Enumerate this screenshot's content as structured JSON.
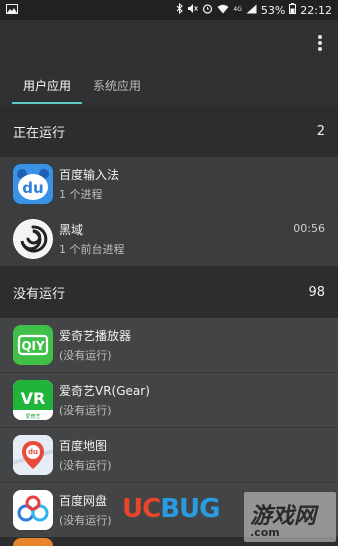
{
  "status_bar": {
    "battery": "53%",
    "time": "22:12",
    "net_label": "4G"
  },
  "tabs": [
    {
      "label": "用户应用"
    },
    {
      "label": "系统应用"
    }
  ],
  "running": {
    "title": "正在运行",
    "count": "2",
    "apps": [
      {
        "name": "百度输入法",
        "sub": "1 个进程",
        "time": "",
        "icon": "baidu-input-icon"
      },
      {
        "name": "黑域",
        "sub": "1 个前台进程",
        "time": "00:56",
        "icon": "brevent-icon"
      }
    ]
  },
  "not_running": {
    "title": "没有运行",
    "count": "98",
    "apps": [
      {
        "name": "爱奇艺播放器",
        "sub": "(没有运行)",
        "icon": "iqiyi-icon"
      },
      {
        "name": "爱奇艺VR(Gear)",
        "sub": "(没有运行)",
        "icon": "iqiyi-vr-icon",
        "icon_caption": "爱奇艺"
      },
      {
        "name": "百度地图",
        "sub": "(没有运行)",
        "icon": "baidu-map-icon",
        "icon_text": "du"
      },
      {
        "name": "百度网盘",
        "sub": "(没有运行)",
        "icon": "baidu-netdisk-icon"
      }
    ]
  },
  "watermark": {
    "brand_part1": "UC",
    "brand_part2": "BUG",
    "cn": "游戏网",
    "domain": ".com"
  },
  "colors": {
    "accent": "#5fc6c9",
    "background": "#2b2d2e",
    "row_bg": "#3b3d3e"
  }
}
